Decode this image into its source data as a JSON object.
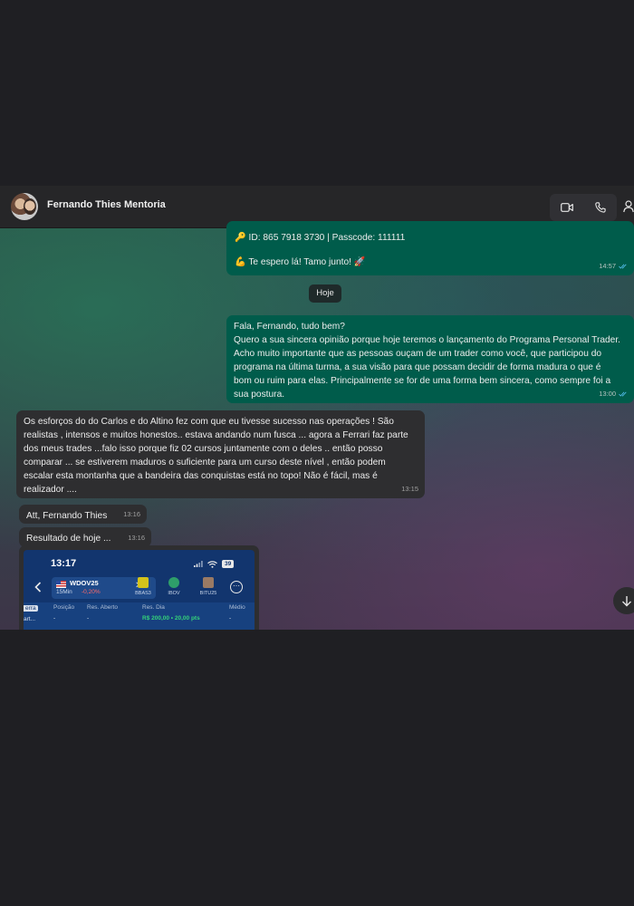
{
  "header": {
    "contact_name": "Fernando Thies Mentoria",
    "video_icon": "video-camera-icon",
    "call_icon": "phone-icon",
    "person_icon": "person-icon"
  },
  "messages": {
    "out1": {
      "line1": "🔑 ID: 865 7918 3730 | Passcode: 111111",
      "line2": "💪 Te espero lá! Tamo junto! 🚀",
      "time": "14:57"
    },
    "day_chip": "Hoje",
    "out2": {
      "text": "Fala, Fernando, tudo bem?\nQuero a sua sincera opinião porque hoje teremos o lançamento do Programa Personal Trader. Acho muito importante que as pessoas ouçam de um trader como você, que participou do programa na última turma, a sua visão para que possam decidir de forma madura o que é bom ou ruim para elas. Principalmente se for de uma forma bem sincera, como sempre foi a sua postura.",
      "time": "13:00"
    },
    "in1": {
      "text": "Os esforços do do Carlos e do Altino fez com que eu tivesse sucesso nas operações ! São realistas , intensos e muitos honestos.. estava andando num fusca ... agora a Ferrari faz parte dos meus trades ...falo isso porque fiz 02 cursos juntamente com o deles .. então posso comparar ... se estiverem maduros o suficiente para um curso deste nível , então podem escalar esta montanha que a bandeira das conquistas está no topo! Não é fácil, mas é realizador ....",
      "time": "13:15"
    },
    "in2": {
      "text": "Att, Fernando Thies",
      "time": "13:16"
    },
    "in3": {
      "text": "Resultado de hoje ...",
      "time": "13:16"
    }
  },
  "screenshot": {
    "clock": "13:17",
    "battery": "39",
    "ticker": "WDOV25",
    "interval": "15Min",
    "change": "-0,20%",
    "symbols": [
      {
        "label": "BBAS3",
        "color": "#d4c21a"
      },
      {
        "label": "IBOV",
        "color": "#2e9e6a"
      },
      {
        "label": "BITU25",
        "color": "#9a7a64"
      }
    ],
    "columns": {
      "posicao": "Posição",
      "res_aberto": "Res. Aberto",
      "res_dia": "Res. Dia",
      "medio": "Médio"
    },
    "values": {
      "posicao": "-",
      "res_aberto": "-",
      "res_dia": "R$ 200,00 • 20,00 pts",
      "medio": "-"
    },
    "side_tab": "erra",
    "side_sub": "art..."
  },
  "colors": {
    "outgoing_bubble": "#005c4b",
    "incoming_bubble": "#2e2e30",
    "read_ticks": "#53bdeb",
    "profit_green": "#34d27a"
  },
  "fab_icon": "arrow-down-icon"
}
